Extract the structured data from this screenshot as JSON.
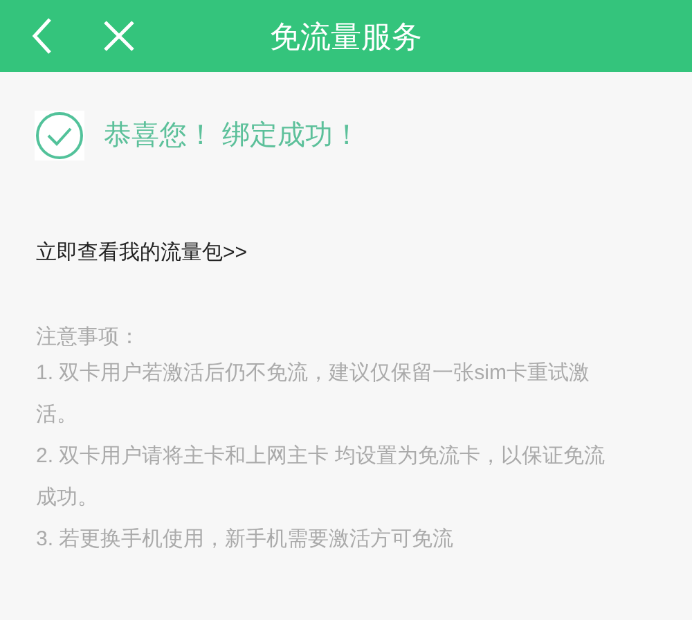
{
  "header": {
    "title": "免流量服务"
  },
  "status": {
    "message": "恭喜您！ 绑定成功！"
  },
  "link": {
    "label": "立即查看我的流量包>>"
  },
  "notes": {
    "title": "注意事项：",
    "items": [
      "1. 双卡用户若激活后仍不免流，建议仅保留一张sim卡重试激活。",
      "2. 双卡用户请将主卡和上网主卡 均设置为免流卡，以保证免流成功。",
      "3. 若更换手机使用，新手机需要激活方可免流"
    ]
  }
}
